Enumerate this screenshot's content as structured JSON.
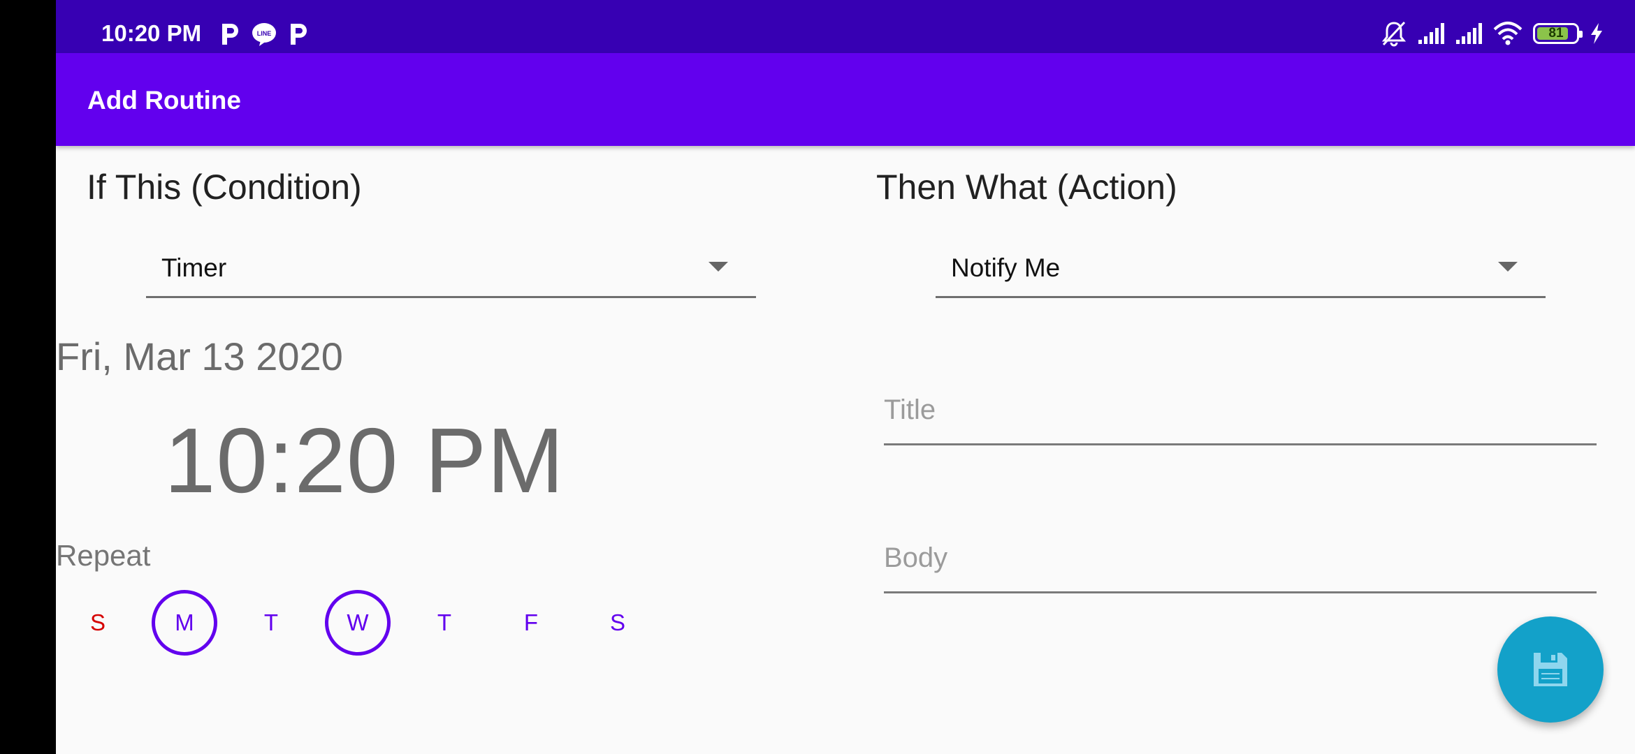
{
  "status_bar": {
    "time": "10:20 PM",
    "battery_level": "81",
    "battery_fraction": 0.81,
    "notification_icons": [
      "p-app-icon",
      "line-app-icon",
      "p-app-icon"
    ],
    "status_icons": [
      "bell-off-icon",
      "signal-icon",
      "signal-icon",
      "wifi-icon",
      "battery-icon",
      "charging-icon"
    ]
  },
  "app_bar": {
    "title": "Add Routine"
  },
  "condition": {
    "heading": "If This (Condition)",
    "selected": "Timer",
    "date": "Fri, Mar 13 2020",
    "time": "10:20 PM",
    "repeat_label": "Repeat",
    "days": [
      {
        "label": "S",
        "selected": false
      },
      {
        "label": "M",
        "selected": true
      },
      {
        "label": "T",
        "selected": false
      },
      {
        "label": "W",
        "selected": true
      },
      {
        "label": "T",
        "selected": false
      },
      {
        "label": "F",
        "selected": false
      },
      {
        "label": "S",
        "selected": false
      }
    ]
  },
  "action": {
    "heading": "Then What (Action)",
    "selected": "Notify Me",
    "title_field": {
      "value": "",
      "placeholder": "Title"
    },
    "body_field": {
      "value": "",
      "placeholder": "Body"
    }
  },
  "fab": {
    "icon": "save-icon"
  },
  "colors": {
    "status_bar": "#3700b3",
    "app_bar": "#6200ee",
    "accent": "#6200ee",
    "sunday": "#d50000",
    "fab": "#13a1c9"
  }
}
